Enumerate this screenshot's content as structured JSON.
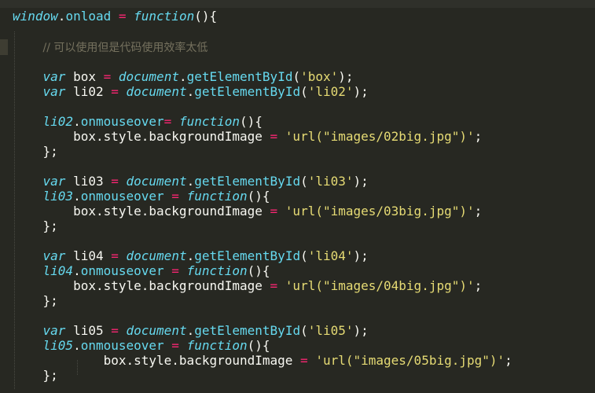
{
  "editor": {
    "lines": [
      {
        "tokens": [
          {
            "t": "window",
            "c": "obj"
          },
          {
            "t": ".",
            "c": "pl"
          },
          {
            "t": "onload",
            "c": "fn"
          },
          {
            "t": " = ",
            "c": "op"
          },
          {
            "t": "function",
            "c": "kw"
          },
          {
            "t": "(){",
            "c": "pl"
          }
        ]
      },
      {
        "tokens": []
      },
      {
        "tokens": [
          {
            "t": "    ",
            "c": "pl"
          },
          {
            "t": "// 可以使用但是代码使用效率太低",
            "c": "cm"
          }
        ]
      },
      {
        "tokens": []
      },
      {
        "tokens": [
          {
            "t": "    ",
            "c": "pl"
          },
          {
            "t": "var",
            "c": "kw"
          },
          {
            "t": " box ",
            "c": "pl"
          },
          {
            "t": "=",
            "c": "op"
          },
          {
            "t": " ",
            "c": "pl"
          },
          {
            "t": "document",
            "c": "obj"
          },
          {
            "t": ".",
            "c": "pl"
          },
          {
            "t": "getElementById",
            "c": "fn"
          },
          {
            "t": "(",
            "c": "pl"
          },
          {
            "t": "'box'",
            "c": "str"
          },
          {
            "t": ");",
            "c": "pl"
          }
        ]
      },
      {
        "tokens": [
          {
            "t": "    ",
            "c": "pl"
          },
          {
            "t": "var",
            "c": "kw"
          },
          {
            "t": " li02 ",
            "c": "pl"
          },
          {
            "t": "=",
            "c": "op"
          },
          {
            "t": " ",
            "c": "pl"
          },
          {
            "t": "document",
            "c": "obj"
          },
          {
            "t": ".",
            "c": "pl"
          },
          {
            "t": "getElementById",
            "c": "fn"
          },
          {
            "t": "(",
            "c": "pl"
          },
          {
            "t": "'li02'",
            "c": "str"
          },
          {
            "t": ");",
            "c": "pl"
          }
        ]
      },
      {
        "tokens": []
      },
      {
        "tokens": [
          {
            "t": "    ",
            "c": "pl"
          },
          {
            "t": "li02",
            "c": "var"
          },
          {
            "t": ".",
            "c": "pl"
          },
          {
            "t": "onmouseover",
            "c": "fn"
          },
          {
            "t": "=",
            "c": "op"
          },
          {
            "t": " ",
            "c": "pl"
          },
          {
            "t": "function",
            "c": "kw"
          },
          {
            "t": "(){",
            "c": "pl"
          }
        ]
      },
      {
        "tokens": [
          {
            "t": "        box.style.backgroundImage ",
            "c": "pl"
          },
          {
            "t": "=",
            "c": "op"
          },
          {
            "t": " ",
            "c": "pl"
          },
          {
            "t": "'url(\"images/02big.jpg\")'",
            "c": "str"
          },
          {
            "t": ";",
            "c": "pl"
          }
        ]
      },
      {
        "tokens": [
          {
            "t": "    };",
            "c": "pl"
          }
        ]
      },
      {
        "tokens": []
      },
      {
        "tokens": [
          {
            "t": "    ",
            "c": "pl"
          },
          {
            "t": "var",
            "c": "kw"
          },
          {
            "t": " li03 ",
            "c": "pl"
          },
          {
            "t": "=",
            "c": "op"
          },
          {
            "t": " ",
            "c": "pl"
          },
          {
            "t": "document",
            "c": "obj"
          },
          {
            "t": ".",
            "c": "pl"
          },
          {
            "t": "getElementById",
            "c": "fn"
          },
          {
            "t": "(",
            "c": "pl"
          },
          {
            "t": "'li03'",
            "c": "str"
          },
          {
            "t": ");",
            "c": "pl"
          }
        ]
      },
      {
        "tokens": [
          {
            "t": "    ",
            "c": "pl"
          },
          {
            "t": "li03",
            "c": "var"
          },
          {
            "t": ".",
            "c": "pl"
          },
          {
            "t": "onmouseover",
            "c": "fn"
          },
          {
            "t": " = ",
            "c": "op"
          },
          {
            "t": "function",
            "c": "kw"
          },
          {
            "t": "(){",
            "c": "pl"
          }
        ]
      },
      {
        "tokens": [
          {
            "t": "        box.style.backgroundImage ",
            "c": "pl"
          },
          {
            "t": "=",
            "c": "op"
          },
          {
            "t": " ",
            "c": "pl"
          },
          {
            "t": "'url(\"images/03big.jpg\")'",
            "c": "str"
          },
          {
            "t": ";",
            "c": "pl"
          }
        ]
      },
      {
        "tokens": [
          {
            "t": "    };",
            "c": "pl"
          }
        ]
      },
      {
        "tokens": []
      },
      {
        "tokens": [
          {
            "t": "    ",
            "c": "pl"
          },
          {
            "t": "var",
            "c": "kw"
          },
          {
            "t": " li04 ",
            "c": "pl"
          },
          {
            "t": "=",
            "c": "op"
          },
          {
            "t": " ",
            "c": "pl"
          },
          {
            "t": "document",
            "c": "obj"
          },
          {
            "t": ".",
            "c": "pl"
          },
          {
            "t": "getElementById",
            "c": "fn"
          },
          {
            "t": "(",
            "c": "pl"
          },
          {
            "t": "'li04'",
            "c": "str"
          },
          {
            "t": ");",
            "c": "pl"
          }
        ]
      },
      {
        "tokens": [
          {
            "t": "    ",
            "c": "pl"
          },
          {
            "t": "li04",
            "c": "var"
          },
          {
            "t": ".",
            "c": "pl"
          },
          {
            "t": "onmouseover",
            "c": "fn"
          },
          {
            "t": " = ",
            "c": "op"
          },
          {
            "t": "function",
            "c": "kw"
          },
          {
            "t": "(){",
            "c": "pl"
          }
        ]
      },
      {
        "tokens": [
          {
            "t": "        box.style.backgroundImage ",
            "c": "pl"
          },
          {
            "t": "=",
            "c": "op"
          },
          {
            "t": " ",
            "c": "pl"
          },
          {
            "t": "'url(\"images/04big.jpg\")'",
            "c": "str"
          },
          {
            "t": ";",
            "c": "pl"
          }
        ]
      },
      {
        "tokens": [
          {
            "t": "    };",
            "c": "pl"
          }
        ]
      },
      {
        "tokens": []
      },
      {
        "tokens": [
          {
            "t": "    ",
            "c": "pl"
          },
          {
            "t": "var",
            "c": "kw"
          },
          {
            "t": " li05 ",
            "c": "pl"
          },
          {
            "t": "=",
            "c": "op"
          },
          {
            "t": " ",
            "c": "pl"
          },
          {
            "t": "document",
            "c": "obj"
          },
          {
            "t": ".",
            "c": "pl"
          },
          {
            "t": "getElementById",
            "c": "fn"
          },
          {
            "t": "(",
            "c": "pl"
          },
          {
            "t": "'li05'",
            "c": "str"
          },
          {
            "t": ");",
            "c": "pl"
          }
        ]
      },
      {
        "tokens": [
          {
            "t": "    ",
            "c": "pl"
          },
          {
            "t": "li05",
            "c": "var"
          },
          {
            "t": ".",
            "c": "pl"
          },
          {
            "t": "onmouseover",
            "c": "fn"
          },
          {
            "t": " = ",
            "c": "op"
          },
          {
            "t": "function",
            "c": "kw"
          },
          {
            "t": "(){",
            "c": "pl"
          }
        ]
      },
      {
        "tokens": [
          {
            "t": "            box.style.backgroundImage ",
            "c": "pl"
          },
          {
            "t": "=",
            "c": "op"
          },
          {
            "t": " ",
            "c": "pl"
          },
          {
            "t": "'url(\"images/05big.jpg\")'",
            "c": "str"
          },
          {
            "t": ";",
            "c": "pl"
          }
        ]
      },
      {
        "tokens": [
          {
            "t": "    };",
            "c": "pl"
          }
        ]
      }
    ]
  },
  "colors": {
    "background": "#272822",
    "keyword": "#66d9ef",
    "operator": "#f92672",
    "string": "#e6db74",
    "comment": "#75715e",
    "plain": "#f8f8f2"
  }
}
